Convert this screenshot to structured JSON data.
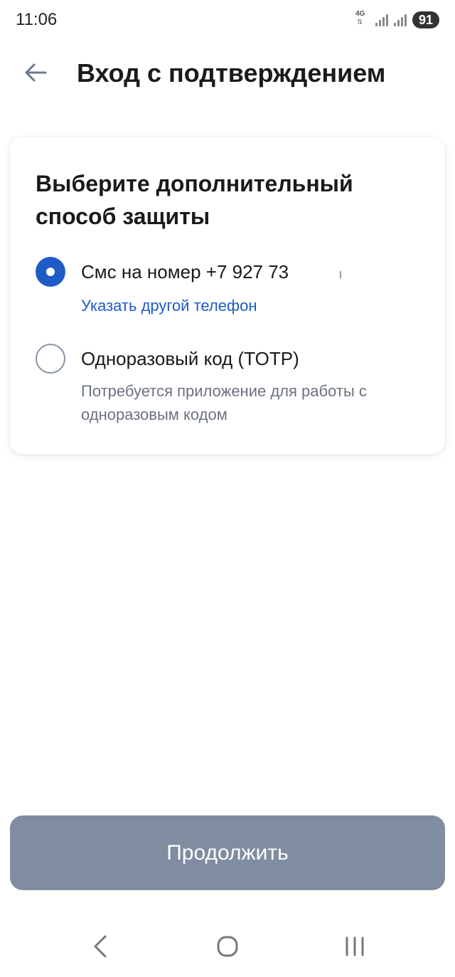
{
  "status_bar": {
    "time": "11:06",
    "network": "4G",
    "battery": "91"
  },
  "header": {
    "back_icon": "arrow-left-icon",
    "title": "Вход с подтверждением"
  },
  "card": {
    "title": "Выберите дополнительный способ защиты",
    "options": [
      {
        "label": "Смс на номер +7 927 73",
        "selected": true,
        "link": "Указать другой телефон"
      },
      {
        "label": "Одноразовый код (TOTP)",
        "selected": false,
        "description": "Потребуется приложение для работы с одноразовым кодом"
      }
    ]
  },
  "continue_button": {
    "label": "Продолжить"
  },
  "nav_bar": {
    "icons": [
      "nav-back-icon",
      "nav-home-icon",
      "nav-recents-icon"
    ]
  },
  "colors": {
    "accent": "#1e5bc6",
    "button_disabled": "#808ca0",
    "muted_text": "#6b7280"
  }
}
